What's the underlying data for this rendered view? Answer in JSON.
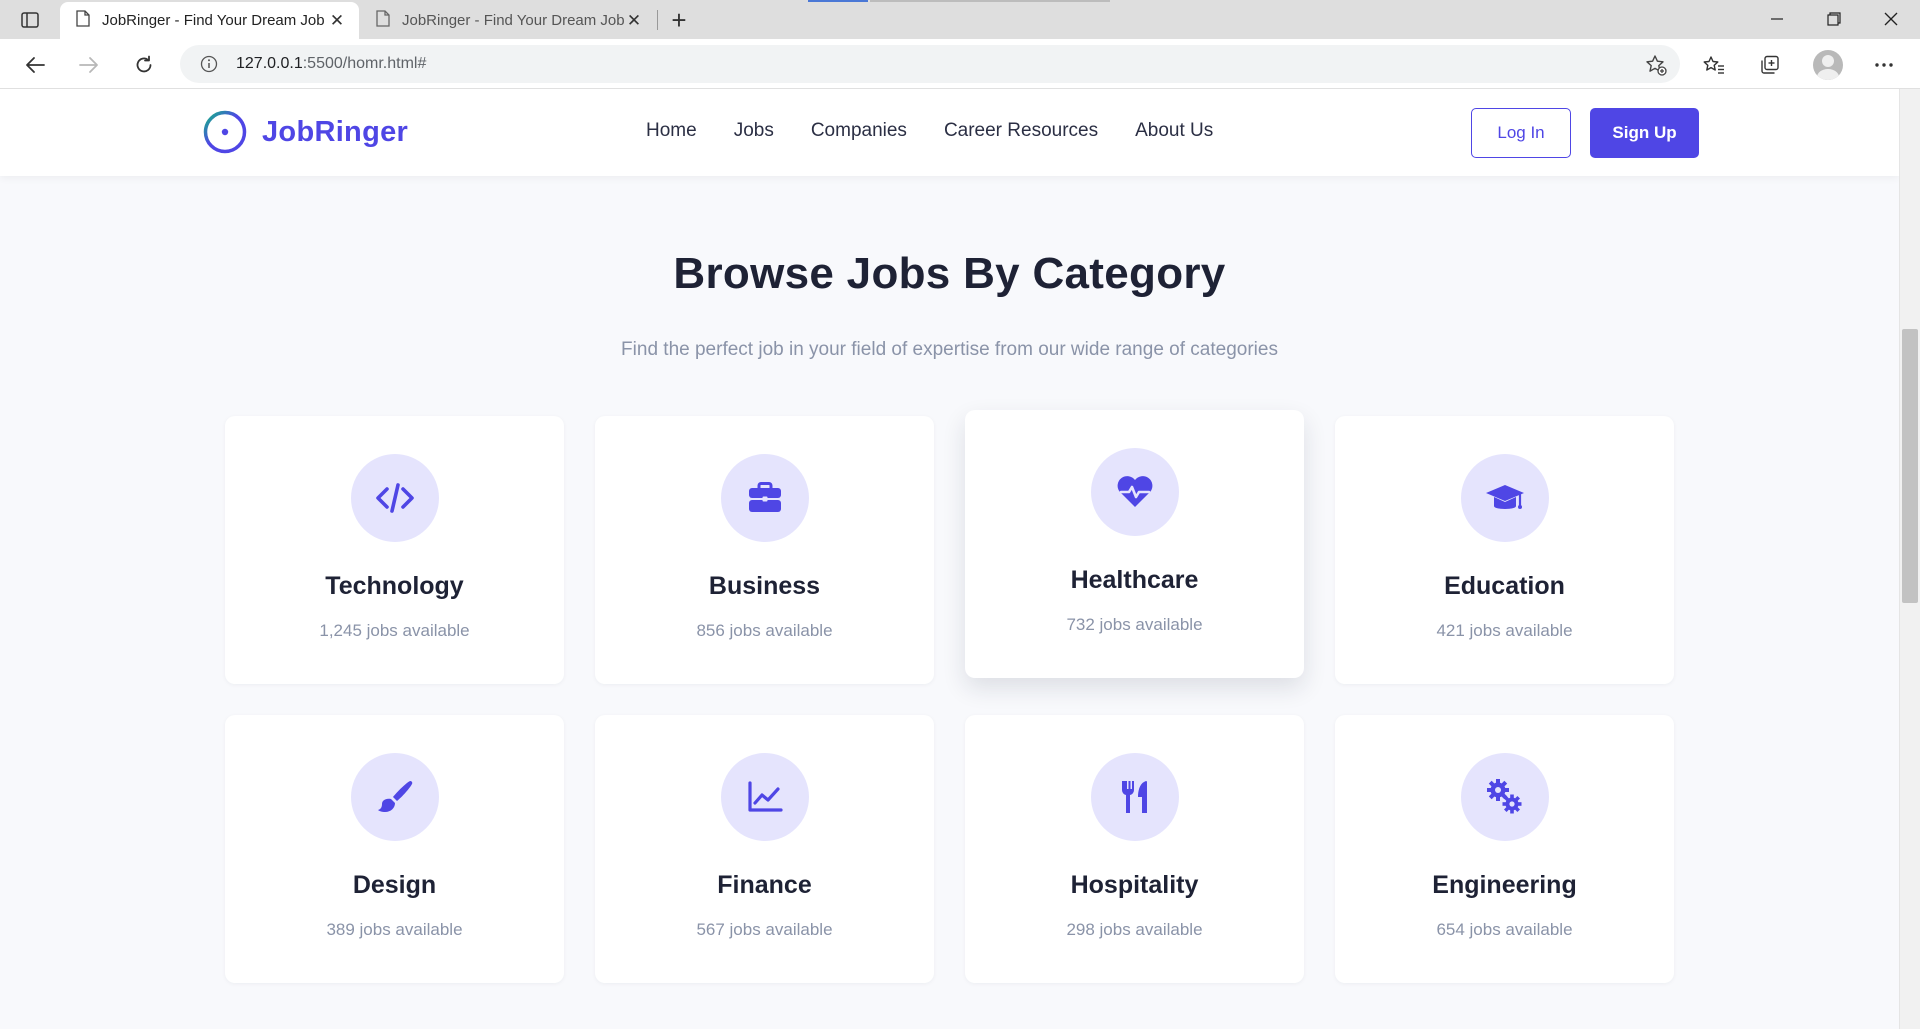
{
  "browser": {
    "tabs": [
      {
        "title": "JobRinger - Find Your Dream Job",
        "active": true
      },
      {
        "title": "JobRinger - Find Your Dream Job",
        "active": false
      }
    ],
    "address": {
      "host": "127.0.0.1",
      "path": ":5500/homr.html#"
    }
  },
  "navbar": {
    "brand": "JobRinger",
    "links": [
      "Home",
      "Jobs",
      "Companies",
      "Career Resources",
      "About Us"
    ],
    "login_label": "Log In",
    "signup_label": "Sign Up"
  },
  "section": {
    "title": "Browse Jobs By Category",
    "subtitle": "Find the perfect job in your field of expertise from our wide range of categories"
  },
  "categories": [
    {
      "name": "Technology",
      "count": "1,245 jobs available",
      "icon": "code-icon"
    },
    {
      "name": "Business",
      "count": "856 jobs available",
      "icon": "briefcase-icon"
    },
    {
      "name": "Healthcare",
      "count": "732 jobs available",
      "icon": "heart-pulse-icon"
    },
    {
      "name": "Education",
      "count": "421 jobs available",
      "icon": "graduation-cap-icon"
    },
    {
      "name": "Design",
      "count": "389 jobs available",
      "icon": "paint-brush-icon"
    },
    {
      "name": "Finance",
      "count": "567 jobs available",
      "icon": "chart-line-icon"
    },
    {
      "name": "Hospitality",
      "count": "298 jobs available",
      "icon": "utensils-icon"
    },
    {
      "name": "Engineering",
      "count": "654 jobs available",
      "icon": "cogs-icon"
    }
  ],
  "colors": {
    "accent": "#4f46e5",
    "icon_bg": "#e5e4fd",
    "page_bg": "#f8f9fc"
  }
}
